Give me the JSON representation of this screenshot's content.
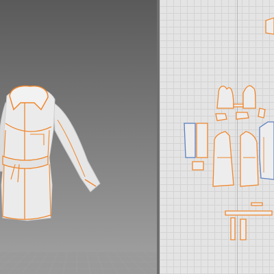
{
  "colors": {
    "seam": "#f0862b",
    "selected_outline": "#5a7fc0",
    "garment_fill": "#e9e9e9",
    "viewport_3d_top": "#5a5a5a",
    "viewport_3d_bottom": "#a3a3a3",
    "viewport_2d_bg": "#e4e4e4"
  },
  "views": {
    "left": "3d-garment-viewport",
    "right": "2d-pattern-window"
  },
  "icons": [
    "jacket-3d-model",
    "pattern-pieces"
  ]
}
